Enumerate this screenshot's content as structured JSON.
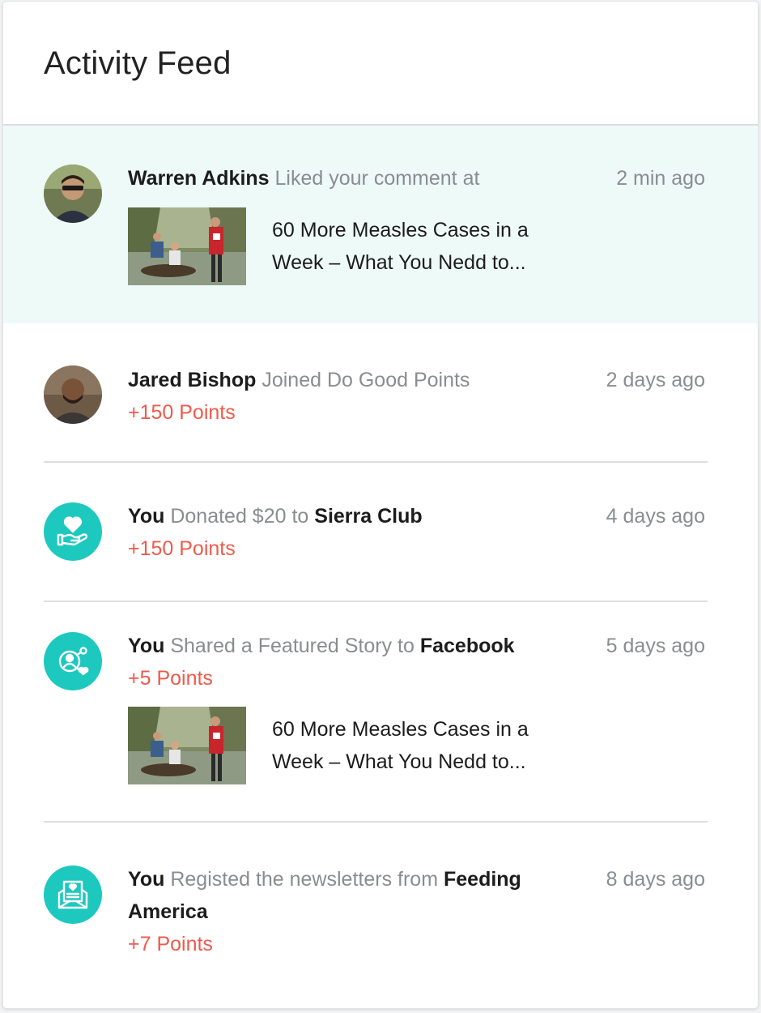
{
  "feed": {
    "title": "Activity Feed",
    "accent_color": "#1dc8bf",
    "points_color": "#ef5a4c",
    "items": [
      {
        "actor": "Warren Adkins",
        "action": "Liked your comment at",
        "time": "2 min ago",
        "avatar": "user-avatar",
        "story_title": "60 More Measles Cases in a Week – What You Nedd to..."
      },
      {
        "actor": "Jared Bishop",
        "action": "Joined Do Good Points",
        "time": "2 days ago",
        "avatar": "user-avatar",
        "points": "+150 Points"
      },
      {
        "actor": "You",
        "action": "Donated $20 to",
        "target": "Sierra Club",
        "time": "4 days ago",
        "icon": "donate-hand-heart-icon",
        "points": "+150 Points"
      },
      {
        "actor": "You",
        "action": "Shared a Featured Story to",
        "target": "Facebook",
        "time": "5 days ago",
        "icon": "share-network-icon",
        "points": "+5 Points",
        "story_title": "60 More Measles Cases in a Week – What You Nedd to..."
      },
      {
        "actor": "You",
        "action": "Registed the newsletters from",
        "target": "Feeding America",
        "time": "8 days ago",
        "icon": "newsletter-icon",
        "points": "+7 Points"
      }
    ]
  }
}
